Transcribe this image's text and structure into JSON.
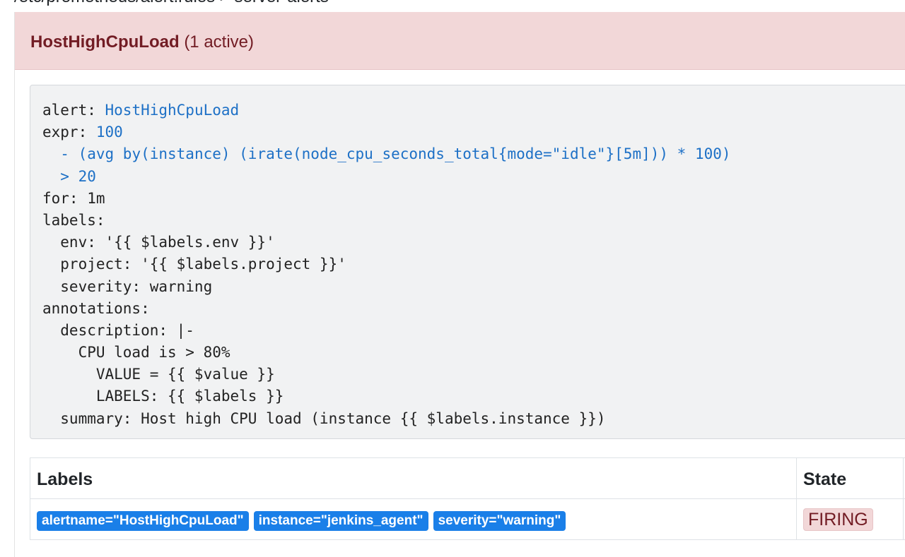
{
  "breadcrumb": "/etc/prometheus/alert.rules > server-alerts",
  "alert_group": {
    "name": "HostHighCpuLoad",
    "active_count": "(1 active)"
  },
  "rule": {
    "lines": [
      {
        "k": "alert: ",
        "v": "HostHighCpuLoad"
      },
      {
        "k": "expr: ",
        "v": "100"
      },
      {
        "k": "  ",
        "v": "- (avg by(instance) (irate(node_cpu_seconds_total{mode=\"idle\"}[5m])) * 100)"
      },
      {
        "k": "  ",
        "v": "> 20"
      },
      {
        "k": "for: 1m",
        "v": ""
      },
      {
        "k": "labels:",
        "v": ""
      },
      {
        "k": "  env: '{{ $labels.env }}'",
        "v": ""
      },
      {
        "k": "  project: '{{ $labels.project }}'",
        "v": ""
      },
      {
        "k": "  severity: warning",
        "v": ""
      },
      {
        "k": "annotations:",
        "v": ""
      },
      {
        "k": "  description: |-",
        "v": ""
      },
      {
        "k": "    CPU load is > 80%",
        "v": ""
      },
      {
        "k": "      VALUE = {{ $value }}",
        "v": ""
      },
      {
        "k": "      LABELS: {{ $labels }}",
        "v": ""
      },
      {
        "k": "  summary: Host high CPU load (instance {{ $labels.instance }})",
        "v": ""
      }
    ]
  },
  "table": {
    "headers": {
      "labels": "Labels",
      "state": "State"
    },
    "rows": [
      {
        "labels": [
          "alertname=\"HostHighCpuLoad\"",
          "instance=\"jenkins_agent\"",
          "severity=\"warning\""
        ],
        "state": "FIRING"
      }
    ]
  },
  "colors": {
    "header_bg": "#f2d7d8",
    "header_text": "#721c24",
    "code_keyword": "#1d70c6",
    "label_badge": "#1a7fe8"
  }
}
